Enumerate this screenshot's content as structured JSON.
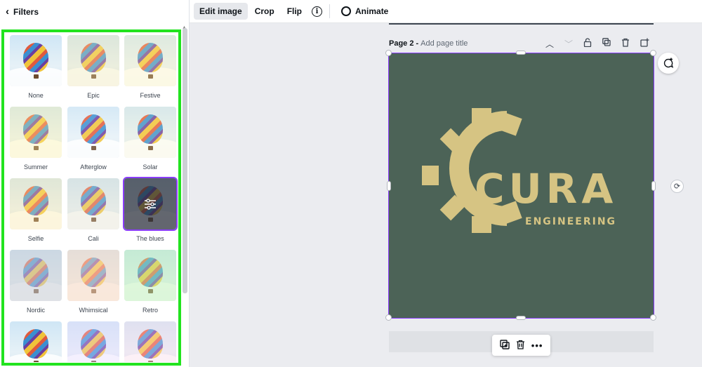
{
  "panel": {
    "title": "Filters",
    "filters": [
      {
        "label": "None",
        "tint": "#ffffff",
        "alpha": 0.0
      },
      {
        "label": "Epic",
        "tint": "#f4e7b0",
        "alpha": 0.35
      },
      {
        "label": "Festive",
        "tint": "#fff2b0",
        "alpha": 0.3
      },
      {
        "label": "Summer",
        "tint": "#fff0a0",
        "alpha": 0.35
      },
      {
        "label": "Afterglow",
        "tint": "#ffffff",
        "alpha": 0.15
      },
      {
        "label": "Solar",
        "tint": "#fff6c0",
        "alpha": 0.2
      },
      {
        "label": "Selfie",
        "tint": "#ffe9a0",
        "alpha": 0.35
      },
      {
        "label": "Cali",
        "tint": "#e6e0c8",
        "alpha": 0.35
      },
      {
        "label": "The blues",
        "tint": "#2b2f3a",
        "alpha": 0.0,
        "selected": true
      },
      {
        "label": "Nordic",
        "tint": "#c8ccd4",
        "alpha": 0.55
      },
      {
        "label": "Whimsical",
        "tint": "#f8d7c0",
        "alpha": 0.55
      },
      {
        "label": "Retro",
        "tint": "#b8f0b0",
        "alpha": 0.45
      },
      {
        "label": "",
        "tint": "#ffffff",
        "alpha": 0.0
      },
      {
        "label": "",
        "tint": "#e8d8ff",
        "alpha": 0.35
      },
      {
        "label": "",
        "tint": "#ffd8e8",
        "alpha": 0.35
      }
    ]
  },
  "toolbar": {
    "edit_image": "Edit image",
    "crop": "Crop",
    "flip": "Flip",
    "info": "i",
    "animate": "Animate"
  },
  "page": {
    "label": "Page 2",
    "separator": "-",
    "add_title": "Add page title"
  },
  "logo": {
    "main": "CURA",
    "sub": "ENGINEERING"
  },
  "colors": {
    "canvas_bg": "#4c6357",
    "logo_gold": "#d6c483",
    "highlight": "#22e31f",
    "selection": "#8b3dff"
  }
}
